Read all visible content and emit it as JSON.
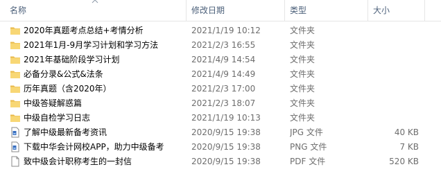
{
  "header": {
    "name": "名称",
    "date": "修改日期",
    "type": "类型",
    "size": "大小"
  },
  "rows": [
    {
      "name": "2020年真题考点总结+考情分析",
      "date": "2021/1/19 10:12",
      "type": "文件夹",
      "size": "",
      "icon": "folder-icon"
    },
    {
      "name": "2021年1月-9月学习计划和学习方法",
      "date": "2021/2/3 16:55",
      "type": "文件夹",
      "size": "",
      "icon": "folder-icon"
    },
    {
      "name": "2021年基础阶段学习计划",
      "date": "2021/4/9 14:54",
      "type": "文件夹",
      "size": "",
      "icon": "folder-icon"
    },
    {
      "name": "必备分录&公式&法条",
      "date": "2021/4/9 14:49",
      "type": "文件夹",
      "size": "",
      "icon": "folder-icon"
    },
    {
      "name": "历年真题（含2020年）",
      "date": "2021/2/3 17:00",
      "type": "文件夹",
      "size": "",
      "icon": "folder-icon"
    },
    {
      "name": "中级答疑解惑篇",
      "date": "2021/2/3 18:07",
      "type": "文件夹",
      "size": "",
      "icon": "folder-icon"
    },
    {
      "name": "中级自检学习日志",
      "date": "2021/1/19 10:13",
      "type": "文件夹",
      "size": "",
      "icon": "folder-icon"
    },
    {
      "name": "了解中级最新备考资讯",
      "date": "2020/9/15 19:38",
      "type": "JPG 文件",
      "size": "40 KB",
      "icon": "image-file-icon"
    },
    {
      "name": "下载中华会计网校APP，助力中级备考",
      "date": "2020/9/15 19:38",
      "type": "PNG 文件",
      "size": "7 KB",
      "icon": "image-file-icon"
    },
    {
      "name": "致中级会计职称考生的一封信",
      "date": "2020/9/15 19:38",
      "type": "PDF 文件",
      "size": "520 KB",
      "icon": "blank-file-icon"
    }
  ],
  "colors": {
    "folder": "#f8d775",
    "header_text": "#4c607a",
    "secondary_text": "#6d6d6d"
  }
}
